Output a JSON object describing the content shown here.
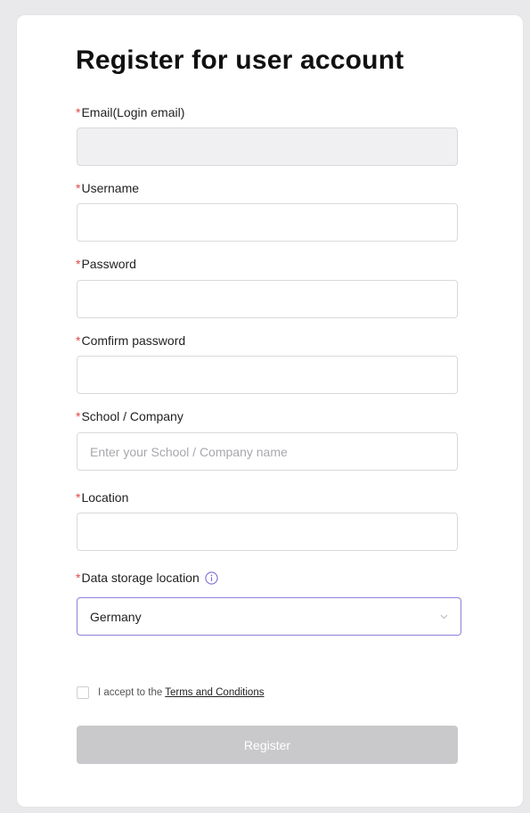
{
  "form": {
    "title": "Register for user account",
    "required_mark": "*",
    "fields": [
      {
        "label": "Email(Login email)",
        "value": "",
        "placeholder": "",
        "disabled": true
      },
      {
        "label": "Username",
        "value": "",
        "placeholder": ""
      },
      {
        "label": "Password",
        "value": "",
        "placeholder": ""
      },
      {
        "label": "Comfirm password",
        "value": "",
        "placeholder": ""
      },
      {
        "label": "School / Company",
        "value": "",
        "placeholder": "Enter your School / Company name"
      },
      {
        "label": "Location",
        "value": "",
        "placeholder": ""
      }
    ],
    "storage": {
      "label": "Data storage location",
      "selected": "Germany",
      "info_icon": "info-circle-icon",
      "dropdown_icon": "chevron-down-icon"
    },
    "terms": {
      "checked": false,
      "text": "I accept to the",
      "link": "Terms and Conditions"
    },
    "register_label": "Register",
    "register_disabled": true
  },
  "colors": {
    "background": "#e9e9eb",
    "card": "#ffffff",
    "required": "#e04848",
    "select_border": "#8c82d8",
    "info_icon": "#7b6fd6",
    "disabled_button": "#c9c9cb",
    "disabled_input": "#f0f0f2"
  }
}
